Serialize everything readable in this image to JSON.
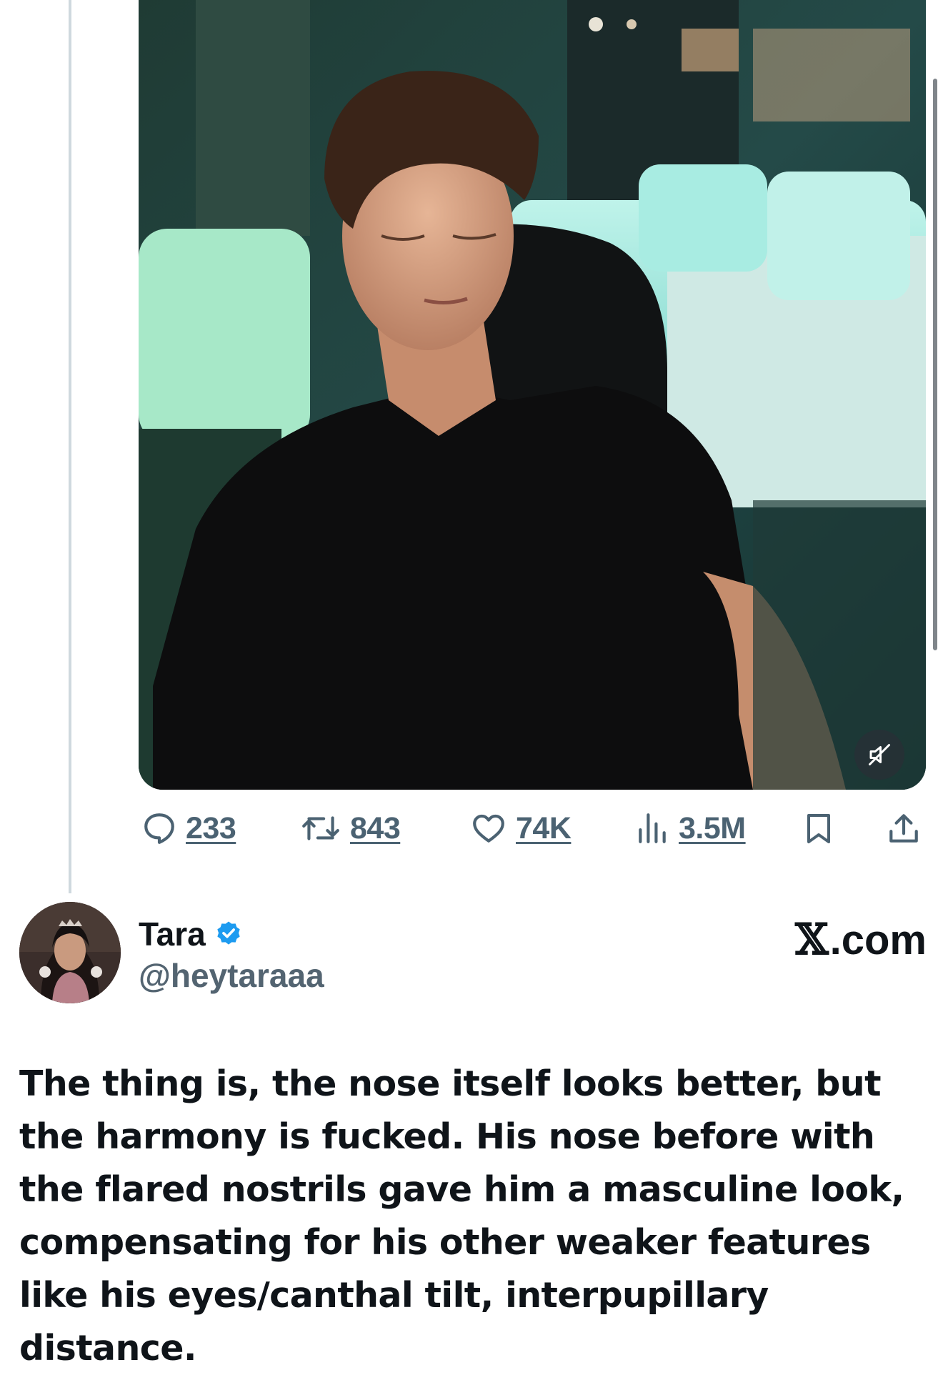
{
  "media": {
    "type": "video",
    "mute_icon": "speaker-muted-icon"
  },
  "actions": {
    "replies": "233",
    "reposts": "843",
    "likes": "74K",
    "views": "3.5M",
    "icons": [
      "reply-icon",
      "repost-icon",
      "like-icon",
      "views-icon",
      "bookmark-icon",
      "share-icon"
    ]
  },
  "tweet": {
    "author_name": "Tara",
    "author_handle": "@heytaraaa",
    "verified": true,
    "site_x": "𝕏",
    "site_rest": ".com",
    "text": "The thing is, the nose itself looks better, but the harmony is fucked. His nose before with the flared nostrils gave him a masculine look, compensating for his other weaker features like his eyes/canthal tilt, interpupillary distance."
  },
  "colors": {
    "text_primary": "#0f1419",
    "text_secondary": "#536471",
    "action_gray": "#4b6272",
    "verified_blue": "#1d9bf0",
    "thread_line": "#cfd9de"
  }
}
